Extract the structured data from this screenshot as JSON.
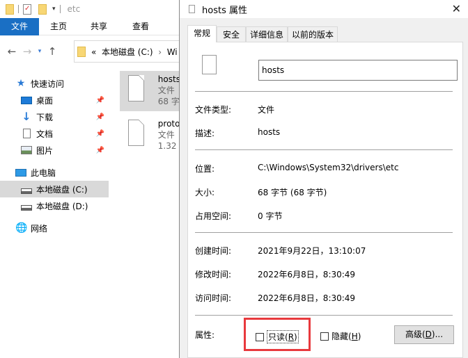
{
  "explorer": {
    "window_title": "etc",
    "ribbon_tabs": [
      "文件",
      "主页",
      "共享",
      "查看"
    ],
    "address": {
      "prefix": "«",
      "path": [
        "本地磁盘 (C:)",
        "Wi"
      ],
      "separator": "›"
    },
    "nav": {
      "quick_access": "快速访问",
      "items": [
        {
          "label": "桌面",
          "icon": "desktop-icon",
          "pinned": true
        },
        {
          "label": "下载",
          "icon": "download-icon",
          "pinned": true
        },
        {
          "label": "文档",
          "icon": "documents-icon",
          "pinned": true
        },
        {
          "label": "图片",
          "icon": "pictures-icon",
          "pinned": true
        }
      ],
      "this_pc": "此电脑",
      "drives": [
        {
          "label": "本地磁盘 (C:)",
          "selected": true
        },
        {
          "label": "本地磁盘 (D:)",
          "selected": false
        }
      ],
      "network": "网络"
    },
    "files": [
      {
        "name": "hosts",
        "type": "文件",
        "size": "68 字",
        "selected": true
      },
      {
        "name": "proto",
        "type": "文件",
        "size": "1.32",
        "selected": false
      }
    ]
  },
  "dialog": {
    "title": "hosts 属性",
    "close_glyph": "✕",
    "tabs": [
      "常规",
      "安全",
      "详细信息",
      "以前的版本"
    ],
    "active_tab": "常规",
    "file_name": "hosts",
    "fields": [
      {
        "label": "文件类型:",
        "value": "文件"
      },
      {
        "label": "描述:",
        "value": "hosts"
      },
      {
        "label": "位置:",
        "value": "C:\\Windows\\System32\\drivers\\etc"
      },
      {
        "label": "大小:",
        "value": "68 字节 (68 字节)"
      },
      {
        "label": "占用空间:",
        "value": "0 字节"
      },
      {
        "label": "创建时间:",
        "value": "2021年9月22日，13:10:07"
      },
      {
        "label": "修改时间:",
        "value": "2022年6月8日，8:30:49"
      },
      {
        "label": "访问时间:",
        "value": "2022年6月8日，8:30:49"
      }
    ],
    "attributes": {
      "label": "属性:",
      "readonly": {
        "label": "只读(",
        "key": "R",
        "suffix": ")",
        "checked": false
      },
      "hidden": {
        "label": "隐藏(",
        "key": "H",
        "suffix": ")",
        "checked": false
      },
      "advanced": {
        "label": "高级(",
        "key": "D",
        "suffix": ")..."
      }
    },
    "highlight_color": "#e8393d"
  }
}
